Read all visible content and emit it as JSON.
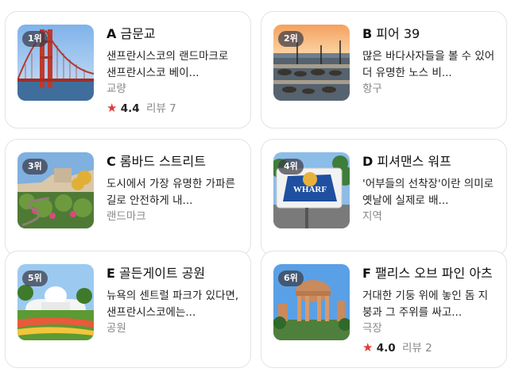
{
  "places": [
    {
      "rank": "1위",
      "letter": "A",
      "name": "금문교",
      "desc": "샌프란시스코의 랜드마크로 샌프란시스코 베이...",
      "category": "교량",
      "rating": "4.4",
      "review_label": "리뷰",
      "review_count": "7",
      "image_icon": "golden-gate-bridge-photo"
    },
    {
      "rank": "2위",
      "letter": "B",
      "name": "피어 39",
      "desc": "많은 바다사자들을 볼 수 있어 더 유명한 노스 비...",
      "category": "항구",
      "image_icon": "pier-39-photo"
    },
    {
      "rank": "3위",
      "letter": "C",
      "name": "롬바드 스트리트",
      "desc": "도시에서 가장 유명한 가파른 길로 안전하게 내...",
      "category": "랜드마크",
      "image_icon": "lombard-street-photo"
    },
    {
      "rank": "4위",
      "letter": "D",
      "name": "피셔맨스 워프",
      "desc": "'어부들의 선착장'이란 의미로 옛날에 실제로 배...",
      "category": "지역",
      "image_icon": "fishermans-wharf-photo"
    },
    {
      "rank": "5위",
      "letter": "E",
      "name": "골든게이트 공원",
      "desc": "뉴욕의 센트럴 파크가 있다면, 샌프란시스코에는...",
      "category": "공원",
      "image_icon": "golden-gate-park-photo"
    },
    {
      "rank": "6위",
      "letter": "F",
      "name": "팰리스 오브 파인 아츠",
      "desc": "거대한 기둥 위에 놓인 돔 지붕과 그 주위를 싸고...",
      "category": "극장",
      "rating": "4.0",
      "review_label": "리뷰",
      "review_count": "2",
      "image_icon": "palace-of-fine-arts-photo"
    }
  ],
  "colors": {
    "star": "#e53935",
    "border": "#e3e3e3",
    "muted": "#888888"
  }
}
